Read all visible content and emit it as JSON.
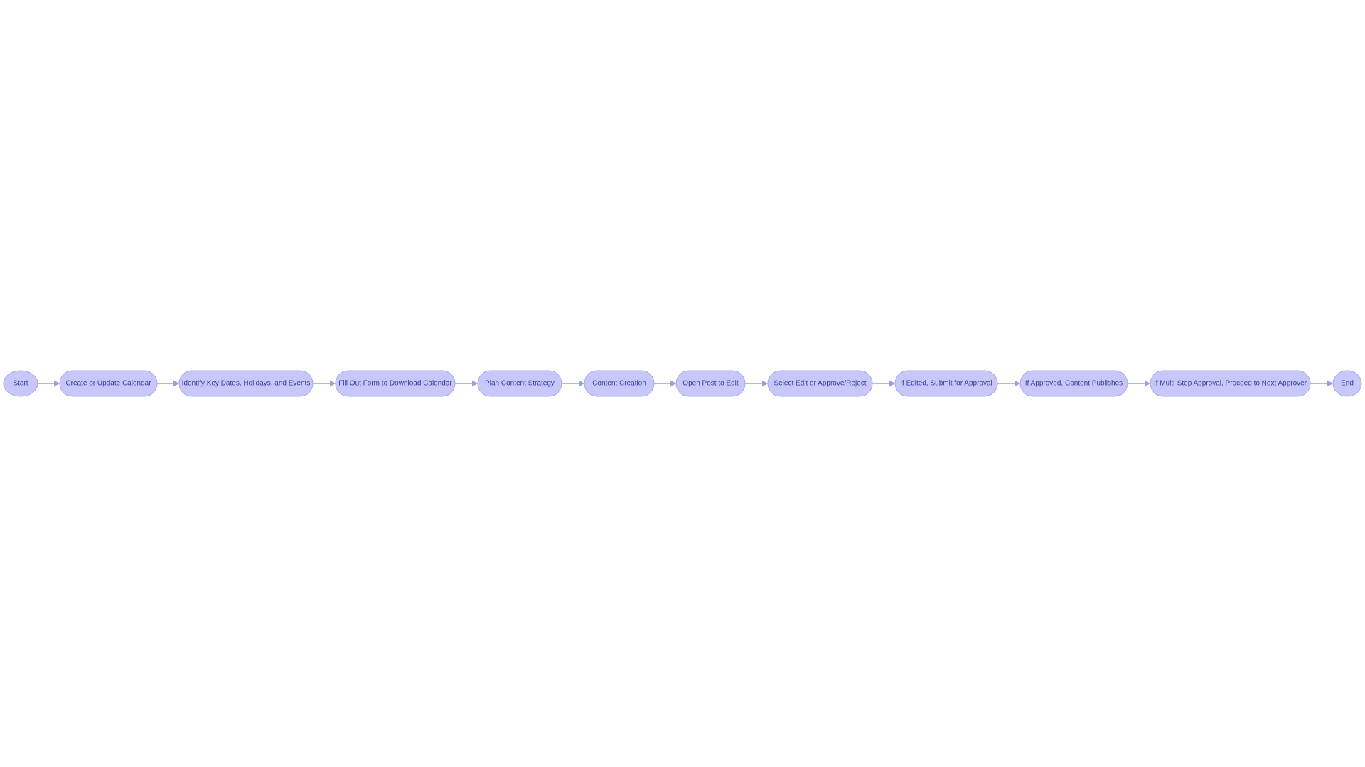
{
  "diagram": {
    "type": "flowchart",
    "direction": "left-to-right",
    "colors": {
      "node_fill": "#c7c7f9",
      "node_stroke": "#a9a9ef",
      "text": "#3b3b9a",
      "edge": "#9d9de6"
    },
    "nodes": [
      {
        "id": "start",
        "label": "Start",
        "shape": "circle"
      },
      {
        "id": "create-calendar",
        "label": "Create or Update Calendar",
        "shape": "stadium"
      },
      {
        "id": "identify-dates",
        "label": "Identify Key Dates, Holidays, and Events",
        "shape": "stadium"
      },
      {
        "id": "fill-form",
        "label": "Fill Out Form to Download Calendar",
        "shape": "stadium"
      },
      {
        "id": "plan-strategy",
        "label": "Plan Content Strategy",
        "shape": "stadium"
      },
      {
        "id": "content-creation",
        "label": "Content Creation",
        "shape": "stadium"
      },
      {
        "id": "open-post",
        "label": "Open Post to Edit",
        "shape": "stadium"
      },
      {
        "id": "select-edit",
        "label": "Select Edit or Approve/Reject",
        "shape": "stadium"
      },
      {
        "id": "submit-approval",
        "label": "If Edited, Submit for Approval",
        "shape": "stadium"
      },
      {
        "id": "content-publishes",
        "label": "If Approved, Content Publishes",
        "shape": "stadium"
      },
      {
        "id": "next-approver",
        "label": "If Multi-Step Approval, Proceed to Next Approver",
        "shape": "stadium"
      },
      {
        "id": "end",
        "label": "End",
        "shape": "circle"
      }
    ],
    "edges": [
      {
        "from": "start",
        "to": "create-calendar"
      },
      {
        "from": "create-calendar",
        "to": "identify-dates"
      },
      {
        "from": "identify-dates",
        "to": "fill-form"
      },
      {
        "from": "fill-form",
        "to": "plan-strategy"
      },
      {
        "from": "plan-strategy",
        "to": "content-creation"
      },
      {
        "from": "content-creation",
        "to": "open-post"
      },
      {
        "from": "open-post",
        "to": "select-edit"
      },
      {
        "from": "select-edit",
        "to": "submit-approval"
      },
      {
        "from": "submit-approval",
        "to": "content-publishes"
      },
      {
        "from": "content-publishes",
        "to": "next-approver"
      },
      {
        "from": "next-approver",
        "to": "end"
      }
    ]
  }
}
